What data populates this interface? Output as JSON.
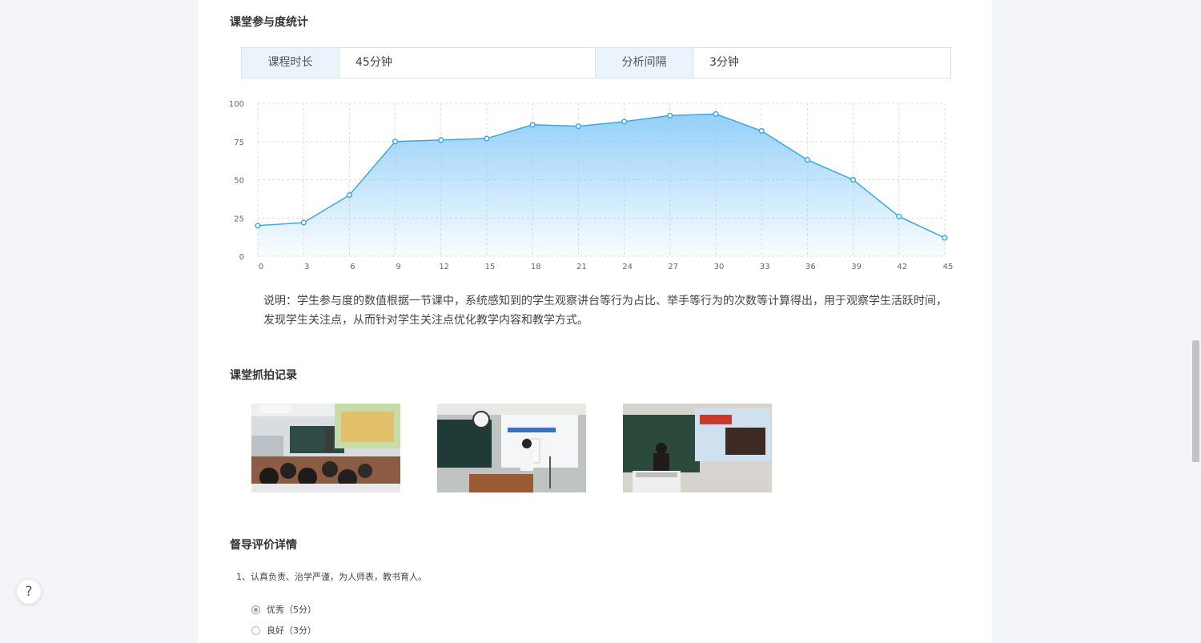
{
  "participation": {
    "title": "课堂参与度统计",
    "duration_label": "课程时长",
    "duration_value": "45分钟",
    "interval_label": "分析间隔",
    "interval_value": "3分钟",
    "note_line1": "说明：学生参与度的数值根据一节课中，系统感知到的学生观察讲台等行为占比、举手等行为的次数等计算得出，用于观察学生活跃时间，",
    "note_line2": "发现学生关注点，从而针对学生关注点优化教学内容和教学方式。"
  },
  "chart_data": {
    "type": "area",
    "x": [
      0,
      3,
      6,
      9,
      12,
      15,
      18,
      21,
      24,
      27,
      30,
      33,
      36,
      39,
      42,
      45
    ],
    "series": [
      {
        "values": [
          20,
          22,
          40,
          75,
          76,
          77,
          86,
          85,
          88,
          92,
          93,
          82,
          63,
          50,
          26,
          12
        ]
      }
    ],
    "xticks": [
      "0",
      "3",
      "6",
      "9",
      "12",
      "15",
      "18",
      "21",
      "24",
      "27",
      "30",
      "33",
      "36",
      "39",
      "42",
      "45"
    ],
    "yticks": [
      "0",
      "25",
      "50",
      "75",
      "100"
    ],
    "ylim": [
      0,
      100
    ],
    "grid": true,
    "line_color": "#3ea6e0",
    "fill_color": "#8ecdf8"
  },
  "snapshots": {
    "title": "课堂抓拍记录"
  },
  "evaluation": {
    "title": "督导评价详情",
    "question1": "1、认真负责、治学严谨，为人师表，教书育人。",
    "options": [
      {
        "label": "优秀（5分）",
        "checked": true
      },
      {
        "label": "良好（3分）",
        "checked": false
      }
    ]
  },
  "help": {
    "symbol": "?"
  },
  "colors": {
    "page_bg": "#f3f5f8",
    "label_bg": "#eaf4fd",
    "border": "#dcdfe6"
  }
}
